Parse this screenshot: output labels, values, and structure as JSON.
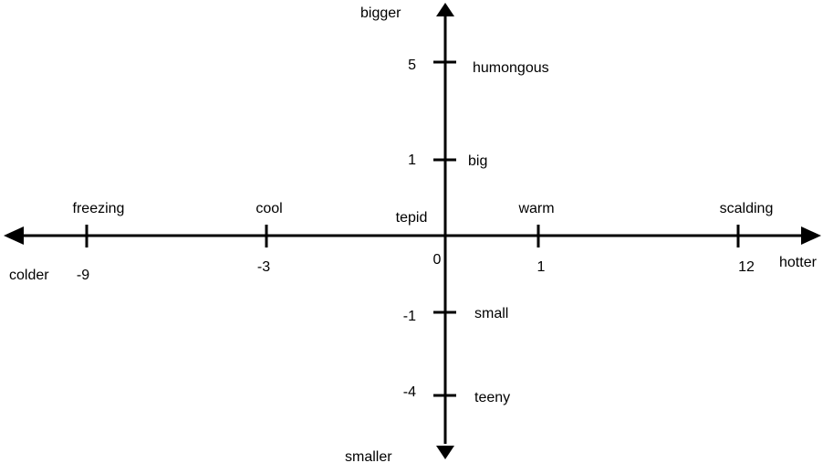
{
  "diagram": {
    "horizontal_axis": {
      "negative_label": "colder",
      "positive_label": "hotter",
      "zero_word": "tepid",
      "origin_number": "0",
      "ticks": [
        {
          "value": "-9",
          "word": "freezing"
        },
        {
          "value": "-3",
          "word": "cool"
        },
        {
          "value": "1",
          "word": "warm"
        },
        {
          "value": "12",
          "word": "scalding"
        }
      ]
    },
    "vertical_axis": {
      "positive_label": "bigger",
      "negative_label": "smaller",
      "ticks": [
        {
          "value": "5",
          "word": "humongous"
        },
        {
          "value": "1",
          "word": "big"
        },
        {
          "value": "-1",
          "word": "small"
        },
        {
          "value": "-4",
          "word": "teeny"
        }
      ]
    },
    "colors": {
      "ink": "#000000",
      "background": "#ffffff"
    }
  }
}
